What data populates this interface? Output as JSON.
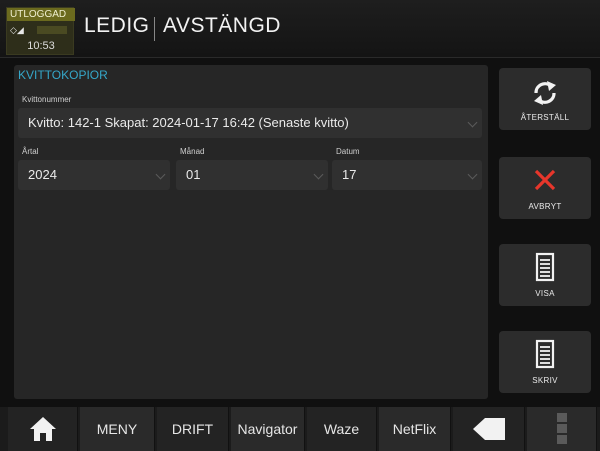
{
  "status": {
    "logged_out": "UTLOGGAD",
    "signal": "◇◢",
    "time": "10:53"
  },
  "header": {
    "state1": "LEDIG",
    "state2": "AVSTÄNGD"
  },
  "panel": {
    "title": "KVITTOKOPIOR",
    "receipt_label": "Kvittonummer",
    "receipt_value": "Kvitto: 142-1  Skapat: 2024-01-17 16:42  (Senaste kvitto)",
    "year_label": "Årtal",
    "year_value": "2024",
    "month_label": "Månad",
    "month_value": "01",
    "day_label": "Datum",
    "day_value": "17"
  },
  "actions": {
    "reset": "ÅTERSTÄLL",
    "cancel": "AVBRYT",
    "show": "VISA",
    "print": "SKRIV"
  },
  "nav": {
    "menu": "MENY",
    "drift": "DRIFT",
    "navigator": "Navigator",
    "waze": "Waze",
    "netflix": "NetFlix"
  },
  "colors": {
    "accent": "#35a7c9",
    "cancel": "#e8362b",
    "status_bar": "#6b6a1e"
  }
}
